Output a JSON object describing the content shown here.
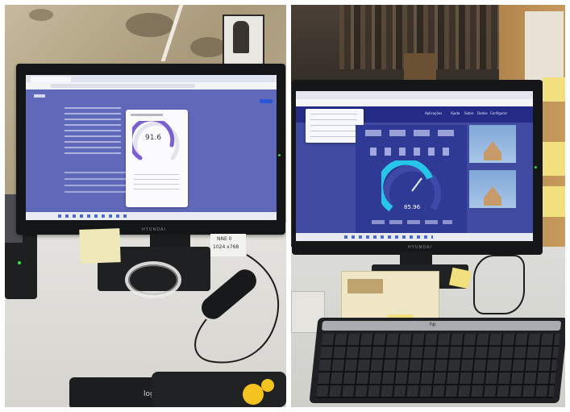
{
  "left_photo": {
    "speedtest": {
      "speed_value": "91.6"
    },
    "monitor": {
      "brand": "HYUNDAI"
    },
    "note": {
      "line1": "NNE 0",
      "line2": "1024 x768"
    },
    "keyboard": {
      "brand": "logitech"
    }
  },
  "right_photo": {
    "speedtest": {
      "speed_value": "85.96",
      "nav_items": [
        "Aplicações",
        "Ajuda",
        "Sobre",
        "Dados",
        "Configurar"
      ]
    },
    "monitor": {
      "brand": "HYUNDAI"
    },
    "keyboard": {
      "brand": "hp"
    }
  },
  "colors": {
    "screen_blue": "#5a63b6",
    "gauge_purple": "#7b5fd1",
    "gauge_cyan": "#27c6e8",
    "sticky_yellow": "#f2e07e"
  }
}
